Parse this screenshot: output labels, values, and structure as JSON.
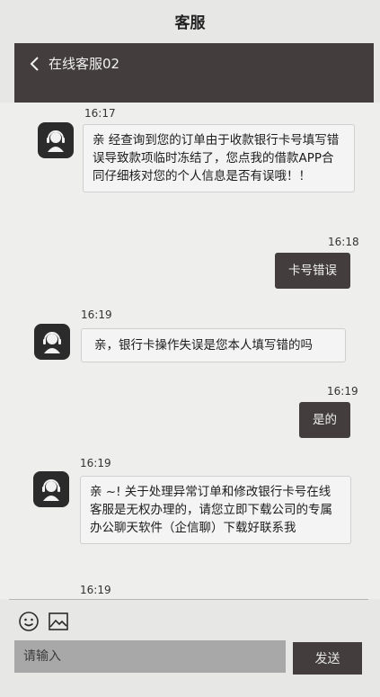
{
  "app": {
    "title": "客服"
  },
  "nav": {
    "back_icon": "chevron-left-icon",
    "title": "在线客服02"
  },
  "messages": [
    {
      "time": "16:17",
      "sender": "agent",
      "text": "亲 经查询到您的订单由于收款银行卡号填写错误导致款项临时冻结了，您点我的借款APP合同仔细核对您的个人信息是否有误哦！！"
    },
    {
      "time": "16:18",
      "sender": "user",
      "text": "卡号错误"
    },
    {
      "time": "16:19",
      "sender": "agent",
      "text": "亲，银行卡操作失误是您本人填写错的吗"
    },
    {
      "time": "16:19",
      "sender": "user",
      "text": "是的"
    },
    {
      "time": "16:19",
      "sender": "agent",
      "text": "亲 ~! 关于处理异常订单和修改银行卡号在线客服是无权办理的，请您立即下载公司的专属办公聊天软件（企信聊）下载好联系我"
    },
    {
      "time": "16:19"
    }
  ],
  "composer": {
    "emoji_icon": "smiley-icon",
    "image_icon": "image-icon",
    "placeholder": "请输入",
    "send_label": "发送"
  }
}
